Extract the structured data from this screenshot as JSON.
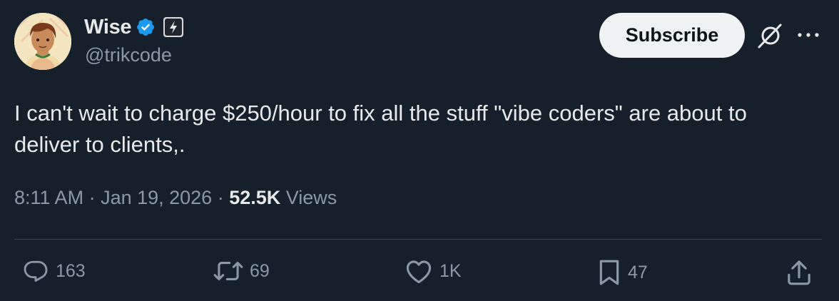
{
  "author": {
    "name": "Wise",
    "handle": "@trikcode"
  },
  "header": {
    "subscribe_label": "Subscribe"
  },
  "tweet": {
    "text": "I can't wait to charge $250/hour to fix all the stuff \"vibe coders\" are about to deliver to clients,.",
    "time": "8:11 AM",
    "separator": " · ",
    "date": "Jan 19, 2026",
    "views_count": "52.5K",
    "views_label": " Views"
  },
  "actions": {
    "replies": "163",
    "reposts": "69",
    "likes": "1K",
    "bookmarks": "47"
  },
  "icons": {
    "verified": "verified-badge-icon",
    "affiliate": "lightning-icon",
    "grok": "grok-icon",
    "more": "more-dots-icon",
    "reply": "reply-icon",
    "repost": "repost-icon",
    "like": "heart-icon",
    "bookmark": "bookmark-icon",
    "share": "share-icon"
  },
  "colors": {
    "background": "#15202b",
    "text_primary": "#e7e9ea",
    "text_secondary": "#8b98a5",
    "verified_blue": "#1d9bf0",
    "button_bg": "#eff3f4"
  }
}
